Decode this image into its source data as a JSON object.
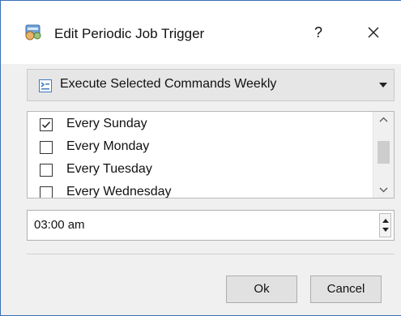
{
  "dialog": {
    "title": "Edit Periodic Job Trigger",
    "help_label": "?"
  },
  "trigger_select": {
    "selected": "Execute Selected Commands Weekly"
  },
  "days": [
    {
      "label": "Every Sunday",
      "checked": true
    },
    {
      "label": "Every Monday",
      "checked": false
    },
    {
      "label": "Every Tuesday",
      "checked": false
    },
    {
      "label": "Every Wednesday",
      "checked": false
    }
  ],
  "time": {
    "value": "03:00 am"
  },
  "buttons": {
    "ok": "Ok",
    "cancel": "Cancel"
  },
  "icons": {
    "app": "scheduler-app-icon",
    "combo": "command-list-icon",
    "help": "help-icon",
    "close": "close-icon"
  },
  "colors": {
    "window_border": "#3a6fb6",
    "dialog_bg": "#f0f0f0"
  }
}
